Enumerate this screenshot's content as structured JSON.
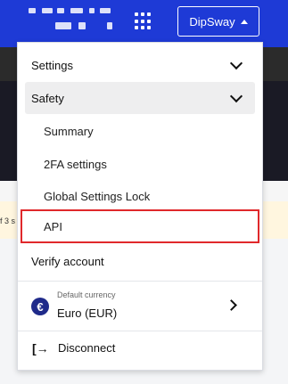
{
  "header": {
    "user_button_label": "DipSway",
    "colors": {
      "header_bg": "#1e3ad6",
      "highlight": "#e0282b"
    },
    "icons": {
      "apps": "grid-dots-icon",
      "caret": "caret-up-icon"
    }
  },
  "background": {
    "fragment_text": "f 3 s"
  },
  "menu": {
    "settings_label": "Settings",
    "safety_label": "Safety",
    "items": [
      {
        "label": "Summary"
      },
      {
        "label": "2FA settings"
      },
      {
        "label": "Global Settings Lock"
      },
      {
        "label": "API"
      }
    ],
    "verify_label": "Verify account",
    "currency": {
      "caption": "Default currency",
      "value": "Euro (EUR)",
      "symbol": "€"
    },
    "disconnect_label": "Disconnect",
    "disconnect_icon": "[→"
  }
}
